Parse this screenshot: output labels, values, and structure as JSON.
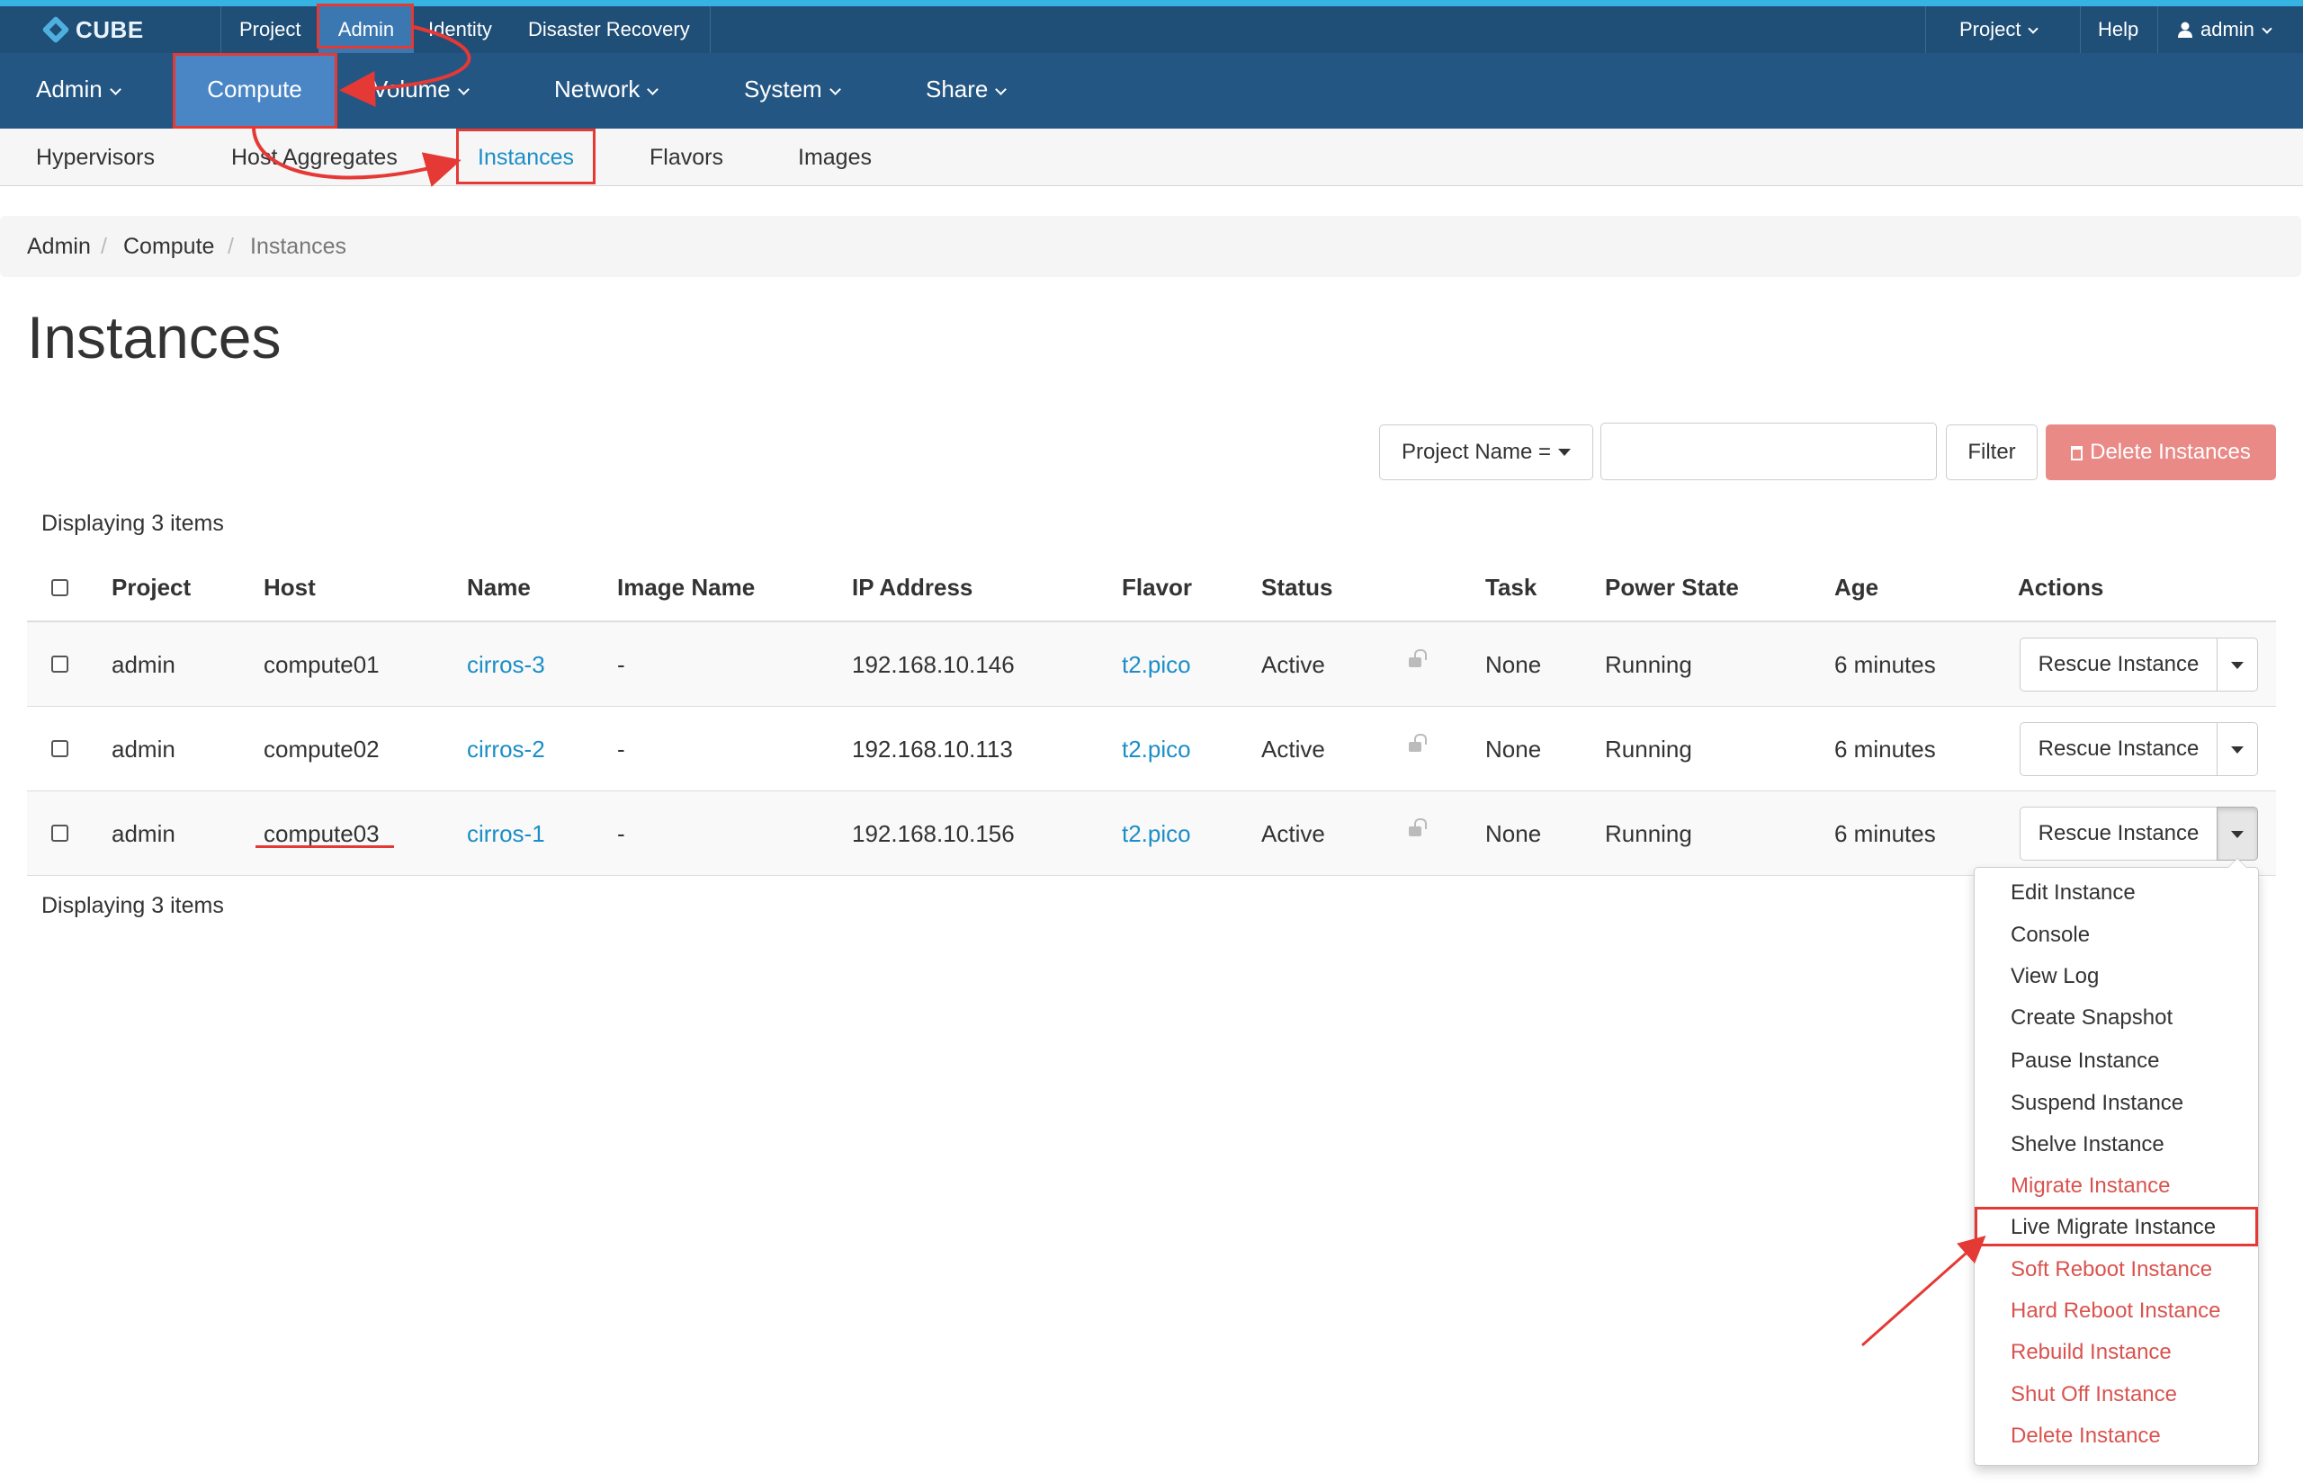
{
  "brand": {
    "logo_text": "CUBE"
  },
  "topbar": {
    "items": [
      {
        "label": "Project"
      },
      {
        "label": "Admin"
      },
      {
        "label": "Identity"
      },
      {
        "label": "Disaster Recovery"
      }
    ],
    "right": {
      "project_label": "Project",
      "help_label": "Help",
      "user_label": "admin"
    }
  },
  "nav2": {
    "items": [
      {
        "label": "Admin"
      },
      {
        "label": "Compute"
      },
      {
        "label": "Volume"
      },
      {
        "label": "Network"
      },
      {
        "label": "System"
      },
      {
        "label": "Share"
      }
    ]
  },
  "nav3": {
    "items": [
      {
        "label": "Hypervisors"
      },
      {
        "label": "Host Aggregates"
      },
      {
        "label": "Instances"
      },
      {
        "label": "Flavors"
      },
      {
        "label": "Images"
      }
    ]
  },
  "breadcrumb": {
    "items": [
      "Admin",
      "Compute",
      "Instances"
    ],
    "separator": "/"
  },
  "page": {
    "title": "Instances"
  },
  "filter": {
    "select_label": "Project Name =",
    "input_value": "",
    "filter_label": "Filter",
    "delete_label": "Delete Instances"
  },
  "table": {
    "count_label": "Displaying 3 items",
    "headers": {
      "project": "Project",
      "host": "Host",
      "name": "Name",
      "image": "Image Name",
      "ip": "IP Address",
      "flavor": "Flavor",
      "status": "Status",
      "task": "Task",
      "power": "Power State",
      "age": "Age",
      "actions": "Actions"
    },
    "rows": [
      {
        "project": "admin",
        "host": "compute01",
        "name": "cirros-3",
        "image": "-",
        "ip": "192.168.10.146",
        "flavor": "t2.pico",
        "status": "Active",
        "task": "None",
        "power": "Running",
        "age": "6 minutes",
        "action": "Rescue Instance"
      },
      {
        "project": "admin",
        "host": "compute02",
        "name": "cirros-2",
        "image": "-",
        "ip": "192.168.10.113",
        "flavor": "t2.pico",
        "status": "Active",
        "task": "None",
        "power": "Running",
        "age": "6 minutes",
        "action": "Rescue Instance"
      },
      {
        "project": "admin",
        "host": "compute03",
        "name": "cirros-1",
        "image": "-",
        "ip": "192.168.10.156",
        "flavor": "t2.pico",
        "status": "Active",
        "task": "None",
        "power": "Running",
        "age": "6 minutes",
        "action": "Rescue Instance"
      }
    ]
  },
  "menu": {
    "items": [
      {
        "label": "Edit Instance"
      },
      {
        "label": "Console"
      },
      {
        "label": "View Log"
      },
      {
        "label": "Create Snapshot"
      },
      {
        "label": "Pause Instance"
      },
      {
        "label": "Suspend Instance"
      },
      {
        "label": "Shelve Instance"
      },
      {
        "label": "Migrate Instance"
      },
      {
        "label": "Live Migrate Instance"
      },
      {
        "label": "Soft Reboot Instance"
      },
      {
        "label": "Hard Reboot Instance"
      },
      {
        "label": "Rebuild Instance"
      },
      {
        "label": "Shut Off Instance"
      },
      {
        "label": "Delete Instance"
      }
    ]
  },
  "colors": {
    "topbar": "#1f4e76",
    "nav": "#245683",
    "active_nav": "#4a86c5",
    "link": "#1b8ec7",
    "danger": "#d9534f",
    "annotation": "#e53935"
  }
}
